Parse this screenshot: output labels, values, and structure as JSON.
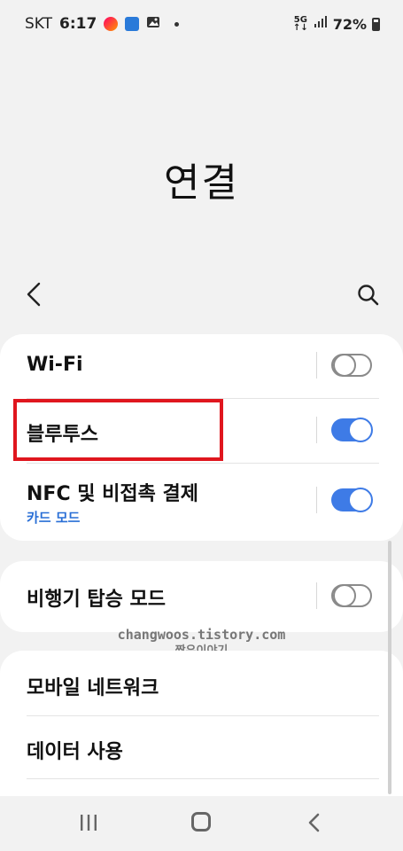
{
  "status_bar": {
    "carrier": "SKT",
    "time": "6:17",
    "network_5g_top": "5G",
    "network_5g_bottom": "↑↓",
    "battery": "72%"
  },
  "page": {
    "title": "연결"
  },
  "toolbar": {
    "back_icon": "chevron-left-icon",
    "search_icon": "search-icon"
  },
  "settings": {
    "wifi": {
      "label": "Wi-Fi",
      "enabled": false
    },
    "bluetooth": {
      "label": "블루투스",
      "enabled": true
    },
    "nfc": {
      "label": "NFC 및 비접촉 결제",
      "sub": "카드 모드",
      "enabled": true
    },
    "airplane": {
      "label": "비행기 탑승 모드",
      "enabled": false
    },
    "mobile_network": {
      "label": "모바일 네트워크"
    },
    "data_usage": {
      "label": "데이터 사용"
    }
  },
  "watermark": {
    "url": "changwoos.tistory.com",
    "name": "짱우이야기"
  },
  "colors": {
    "accent": "#3e7be6",
    "sub_text": "#2a6fd6",
    "highlight": "#e0161e"
  }
}
